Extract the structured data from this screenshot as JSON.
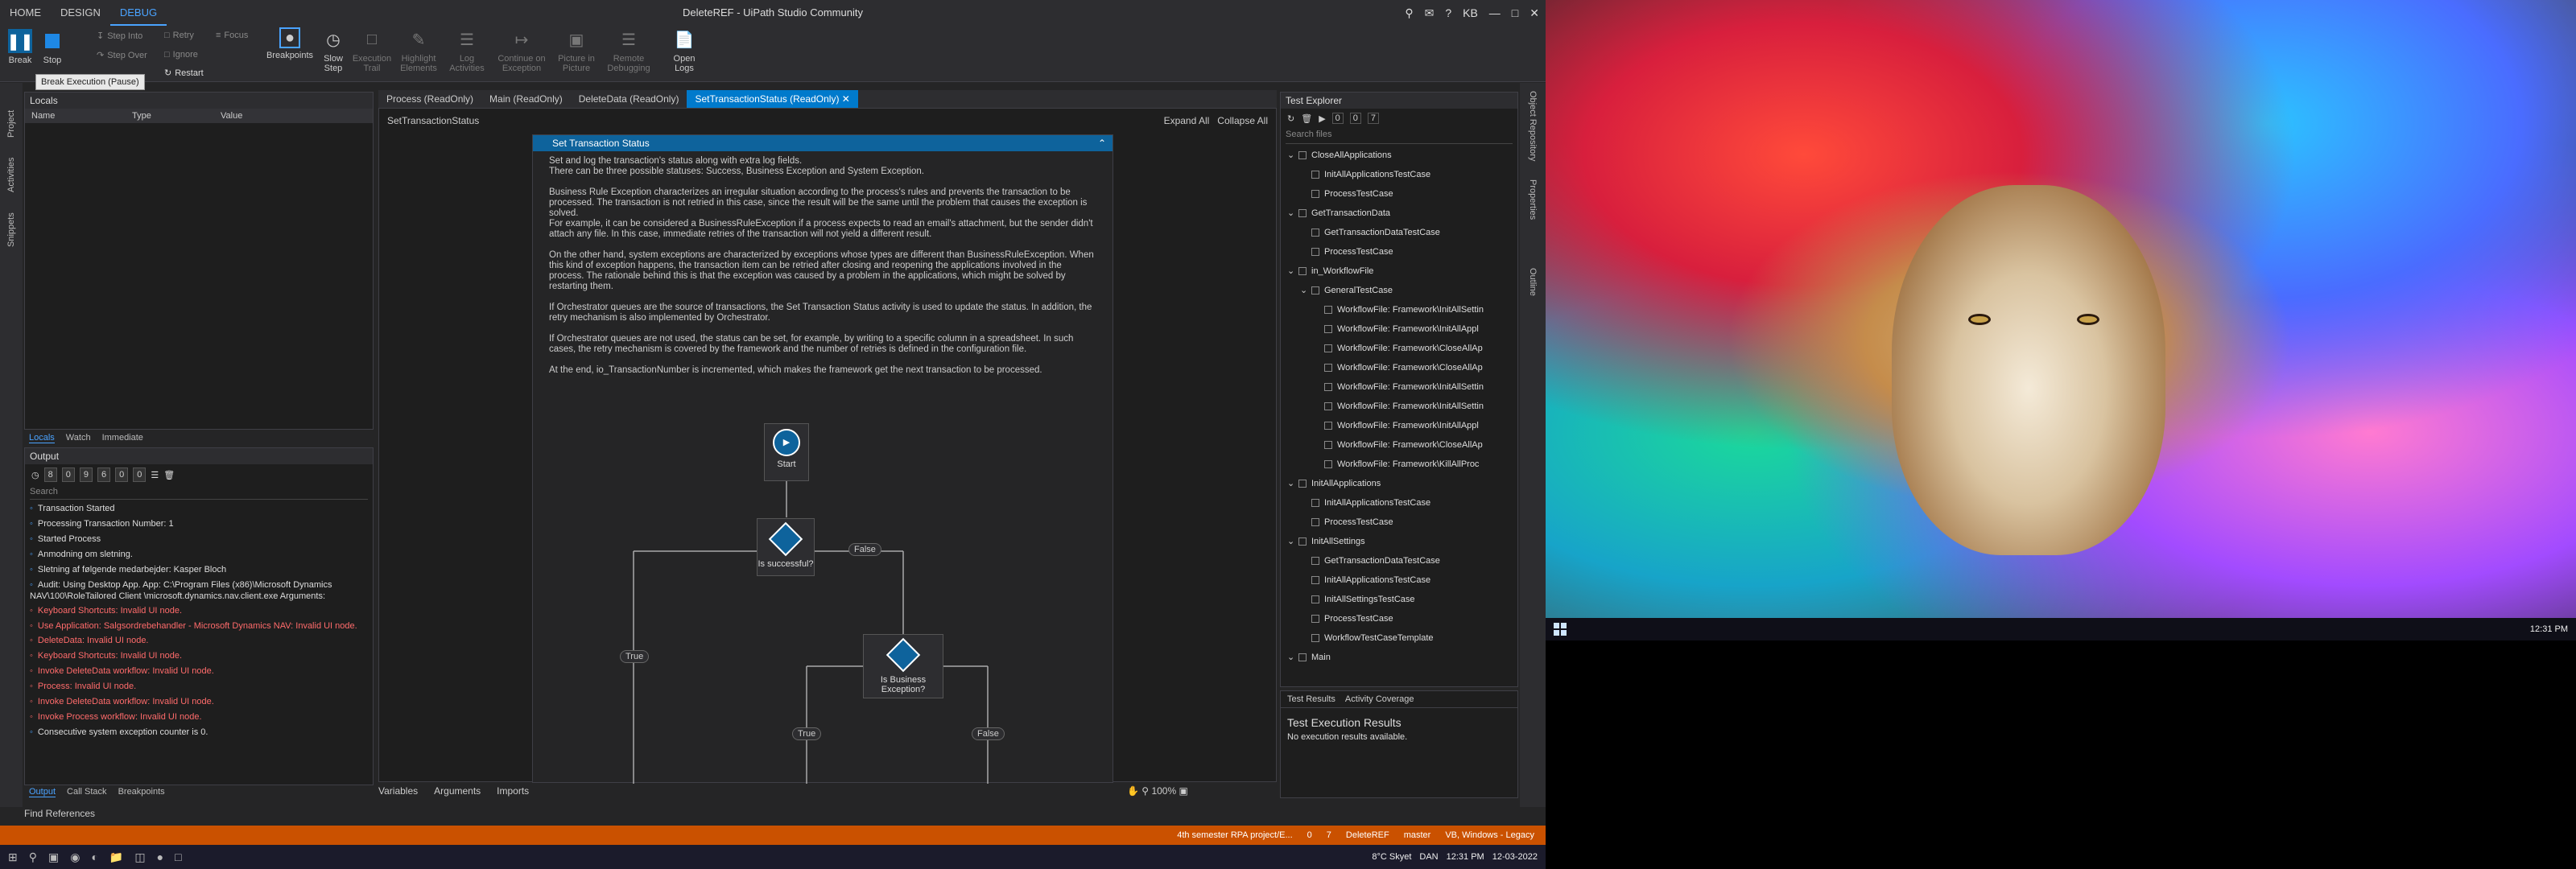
{
  "titlebar": {
    "tabs": [
      "HOME",
      "DESIGN",
      "DEBUG"
    ],
    "title": "DeleteREF - UiPath Studio Community",
    "user": "KB"
  },
  "ribbon": {
    "break": "Break",
    "stop": "Stop",
    "step_into": "Step Into",
    "step_over": "Step Over",
    "retry": "Retry",
    "ignore": "Ignore",
    "focus": "Focus",
    "restart": "Restart",
    "breakpoints": "Breakpoints",
    "slow_step_1": "Slow",
    "slow_step_2": "Step",
    "execution_trail_1": "Execution",
    "execution_trail_2": "Trail",
    "highlight_1": "Highlight",
    "highlight_2": "Elements",
    "log_1": "Log",
    "log_2": "Activities",
    "continue_1": "Continue on",
    "continue_2": "Exception",
    "pip_1": "Picture in",
    "pip_2": "Picture",
    "remote_1": "Remote",
    "remote_2": "Debugging",
    "open_logs_1": "Open",
    "open_logs_2": "Logs",
    "tooltip": "Break Execution (Pause)"
  },
  "left_strip": [
    "Project",
    "Activities",
    "Snippets"
  ],
  "locals": {
    "title": "Locals",
    "columns": [
      "Name",
      "Type",
      "Value"
    ],
    "tabs": [
      "Locals",
      "Watch",
      "Immediate"
    ]
  },
  "output": {
    "title": "Output",
    "counts": [
      "8",
      "0",
      "9",
      "6",
      "0",
      "0"
    ],
    "search_placeholder": "Search",
    "lines": [
      {
        "text": "Transaction Started",
        "type": "ok"
      },
      {
        "text": "Processing Transaction Number: 1",
        "type": "ok"
      },
      {
        "text": "Started Process",
        "type": "ok"
      },
      {
        "text": "Anmodning om sletning.",
        "type": "ok"
      },
      {
        "text": "Sletning af følgende medarbejder: Kasper Bloch",
        "type": "ok"
      },
      {
        "text": "Audit: Using Desktop App. App: C:\\Program Files (x86)\\Microsoft Dynamics NAV\\100\\RoleTailored Client \\microsoft.dynamics.nav.client.exe Arguments:",
        "type": "ok"
      },
      {
        "text": "Keyboard Shortcuts: Invalid UI node.",
        "type": "err"
      },
      {
        "text": "Use Application: Salgsordrebehandler - Microsoft Dynamics NAV: Invalid UI node.",
        "type": "err"
      },
      {
        "text": "DeleteData: Invalid UI node.",
        "type": "err"
      },
      {
        "text": "Keyboard Shortcuts: Invalid UI node.",
        "type": "err"
      },
      {
        "text": "Invoke DeleteData workflow: Invalid UI node.",
        "type": "err"
      },
      {
        "text": "Process: Invalid UI node.",
        "type": "err"
      },
      {
        "text": "Invoke DeleteData workflow: Invalid UI node.",
        "type": "err"
      },
      {
        "text": "Invoke Process workflow: Invalid UI node.",
        "type": "err"
      },
      {
        "text": "Consecutive system exception counter is 0.",
        "type": "ok"
      }
    ],
    "tabs": [
      "Output",
      "Call Stack",
      "Breakpoints"
    ]
  },
  "find_references": "Find References",
  "docs": [
    "Process (ReadOnly)",
    "Main (ReadOnly)",
    "DeleteData (ReadOnly)",
    "SetTransactionStatus (ReadOnly)"
  ],
  "designer": {
    "breadcrumb": "SetTransactionStatus",
    "expand_all": "Expand All",
    "collapse_all": "Collapse All",
    "activity_title": "Set Transaction Status",
    "paragraphs": [
      "Set and log the transaction's status along with extra log fields.\nThere can be three possible statuses: Success, Business Exception and System Exception.",
      "Business Rule Exception characterizes an irregular situation according to the process's rules and prevents the transaction to be processed. The transaction is not retried in this case, since the result will be the same until the problem that causes the exception is solved.\nFor example, it can be considered a BusinessRuleException if a process expects to read an email's attachment, but the sender didn't attach any file. In this case, immediate retries of the transaction will not yield a different result.",
      "On the other hand, system exceptions are characterized by exceptions whose types are different than BusinessRuleException. When this kind of exception happens, the transaction item can be retried after closing and reopening the applications involved in the process. The rationale behind this is that the exception was caused by a problem in the applications, which might be solved by restarting them.",
      "If Orchestrator queues are the source of transactions, the Set Transaction Status activity is used to update the status. In addition, the retry mechanism is also implemented by Orchestrator.",
      "If Orchestrator queues are not used, the status can be set, for example, by writing to a specific column in a spreadsheet. In such cases, the retry mechanism is covered by the framework and the number of retries is defined in the configuration file.",
      "At the end, io_TransactionNumber is incremented, which makes the framework get the next transaction to be processed."
    ],
    "start": "Start",
    "is_successful": "Is successful?",
    "is_business_exception": "Is Business Exception?",
    "true_label": "True",
    "false_label": "False",
    "bottom_tabs": [
      "Variables",
      "Arguments",
      "Imports"
    ],
    "zoom": "100%"
  },
  "test_explorer": {
    "title": "Test Explorer",
    "counts": [
      "0",
      "0",
      "7"
    ],
    "search_placeholder": "Search files",
    "tree": [
      {
        "label": "CloseAllApplications",
        "level": 0,
        "fold": "⌄"
      },
      {
        "label": "InitAllApplicationsTestCase",
        "level": 1,
        "fold": ""
      },
      {
        "label": "ProcessTestCase",
        "level": 1,
        "fold": ""
      },
      {
        "label": "GetTransactionData",
        "level": 0,
        "fold": "⌄"
      },
      {
        "label": "GetTransactionDataTestCase",
        "level": 1,
        "fold": ""
      },
      {
        "label": "ProcessTestCase",
        "level": 1,
        "fold": ""
      },
      {
        "label": "in_WorkflowFile",
        "level": 0,
        "fold": "⌄"
      },
      {
        "label": "GeneralTestCase",
        "level": 1,
        "fold": "⌄"
      },
      {
        "label": "WorkflowFile: Framework\\InitAllSettin",
        "level": 2,
        "fold": ""
      },
      {
        "label": "WorkflowFile: Framework\\InitAllAppl",
        "level": 2,
        "fold": ""
      },
      {
        "label": "WorkflowFile: Framework\\CloseAllAp",
        "level": 2,
        "fold": ""
      },
      {
        "label": "WorkflowFile: Framework\\CloseAllAp",
        "level": 2,
        "fold": ""
      },
      {
        "label": "WorkflowFile: Framework\\InitAllSettin",
        "level": 2,
        "fold": ""
      },
      {
        "label": "WorkflowFile: Framework\\InitAllSettin",
        "level": 2,
        "fold": ""
      },
      {
        "label": "WorkflowFile: Framework\\InitAllAppl",
        "level": 2,
        "fold": ""
      },
      {
        "label": "WorkflowFile: Framework\\CloseAllAp",
        "level": 2,
        "fold": ""
      },
      {
        "label": "WorkflowFile: Framework\\KillAllProc",
        "level": 2,
        "fold": ""
      },
      {
        "label": "InitAllApplications",
        "level": 0,
        "fold": "⌄"
      },
      {
        "label": "InitAllApplicationsTestCase",
        "level": 1,
        "fold": ""
      },
      {
        "label": "ProcessTestCase",
        "level": 1,
        "fold": ""
      },
      {
        "label": "InitAllSettings",
        "level": 0,
        "fold": "⌄"
      },
      {
        "label": "GetTransactionDataTestCase",
        "level": 1,
        "fold": ""
      },
      {
        "label": "InitAllApplicationsTestCase",
        "level": 1,
        "fold": ""
      },
      {
        "label": "InitAllSettingsTestCase",
        "level": 1,
        "fold": ""
      },
      {
        "label": "ProcessTestCase",
        "level": 1,
        "fold": ""
      },
      {
        "label": "WorkflowTestCaseTemplate",
        "level": 1,
        "fold": ""
      },
      {
        "label": "Main",
        "level": 0,
        "fold": "⌄"
      }
    ],
    "result_tabs": [
      "Test Results",
      "Activity Coverage"
    ],
    "result_title": "Test Execution Results",
    "result_text": "No execution results available."
  },
  "right_strip": [
    "Object Repository",
    "Properties",
    "Outline"
  ],
  "statusbar": {
    "branch_project": "4th semester RPA project/E...",
    "warnings": "0",
    "changes": "7",
    "repo": "DeleteREF",
    "branch": "master",
    "env": "VB, Windows - Legacy"
  },
  "taskbar": {
    "weather": "8°C  Skyet",
    "lang": "DAN",
    "time": "12:31 PM",
    "date": "12-03-2022"
  },
  "second_monitor": {
    "time": "12:31 PM"
  }
}
